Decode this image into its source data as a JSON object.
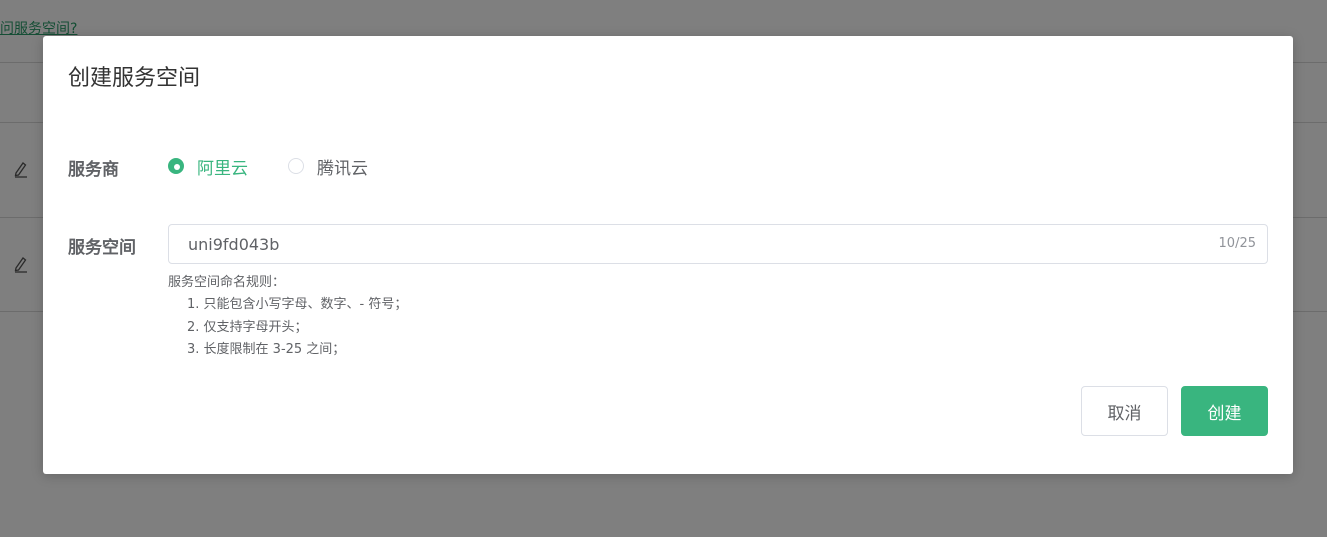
{
  "background": {
    "link_text": "问服务空间?"
  },
  "dialog": {
    "title": "创建服务空间",
    "provider_label": "服务商",
    "providers": [
      {
        "label": "阿里云",
        "checked": true
      },
      {
        "label": "腾讯云",
        "checked": false
      }
    ],
    "space_label": "服务空间",
    "space_input": {
      "value": "uni9fd043b",
      "count": "10/25"
    },
    "hints": [
      "服务空间命名规则：",
      "1. 只能包含小写字母、数字、- 符号；",
      "2. 仅支持字母开头；",
      "3. 长度限制在 3-25 之间；"
    ],
    "cancel_label": "取消",
    "create_label": "创建"
  },
  "colors": {
    "accent": "#39b57f",
    "overlay": "rgba(0,0,0,0.5)"
  }
}
